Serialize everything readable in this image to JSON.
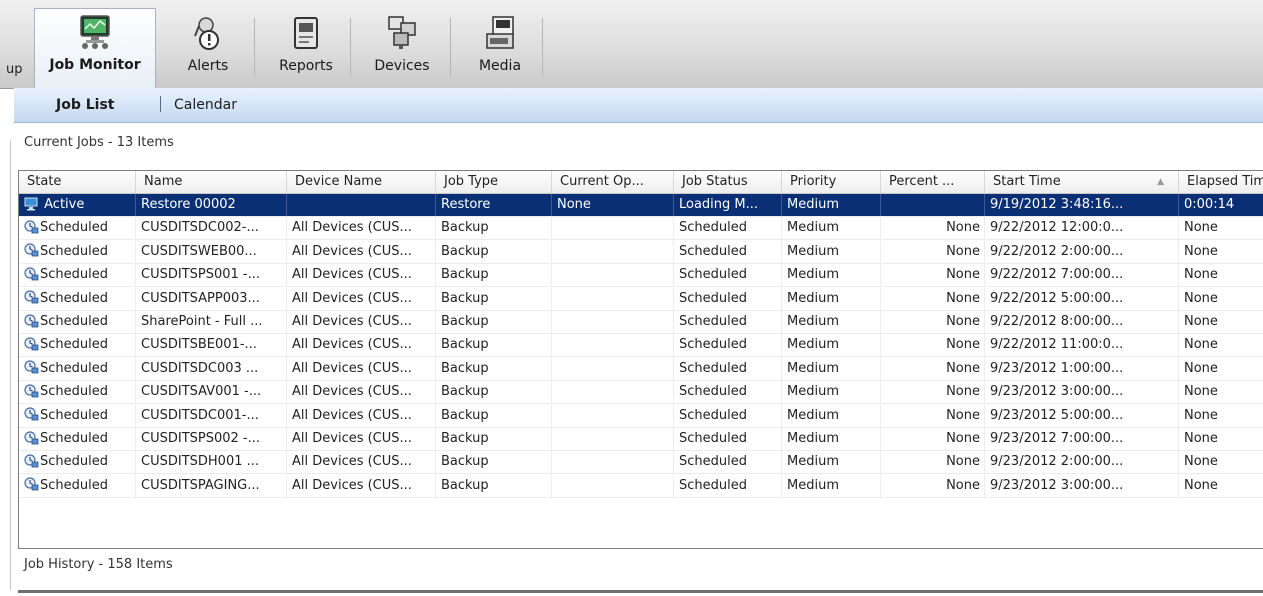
{
  "toolbar": {
    "cut_label": "up",
    "tabs": [
      {
        "label": "Job Monitor",
        "icon": "job-monitor-icon"
      },
      {
        "label": "Alerts",
        "icon": "alerts-icon"
      },
      {
        "label": "Reports",
        "icon": "reports-icon"
      },
      {
        "label": "Devices",
        "icon": "devices-icon"
      },
      {
        "label": "Media",
        "icon": "media-icon"
      }
    ]
  },
  "subnav": {
    "job_list": "Job List",
    "calendar": "Calendar"
  },
  "current_jobs": {
    "title": "Current Jobs - 13 Items",
    "columns": [
      "State",
      "Name",
      "Device Name",
      "Job Type",
      "Current Op...",
      "Job Status",
      "Priority",
      "Percent ...",
      "Start Time",
      "Elapsed Time"
    ],
    "rows": [
      [
        "Active",
        "Restore 00002",
        "",
        "Restore",
        "None",
        "Loading M...",
        "Medium",
        "",
        "9/19/2012 3:48:16...",
        "0:00:14"
      ],
      [
        "Scheduled",
        "CUSDITSDC002-...",
        "All Devices (CUS...",
        "Backup",
        "",
        "Scheduled",
        "Medium",
        "None",
        "9/22/2012 12:00:0...",
        "None"
      ],
      [
        "Scheduled",
        "CUSDITSWEB00...",
        "All Devices (CUS...",
        "Backup",
        "",
        "Scheduled",
        "Medium",
        "None",
        "9/22/2012 2:00:00...",
        "None"
      ],
      [
        "Scheduled",
        "CUSDITSPS001 -...",
        "All Devices (CUS...",
        "Backup",
        "",
        "Scheduled",
        "Medium",
        "None",
        "9/22/2012 7:00:00...",
        "None"
      ],
      [
        "Scheduled",
        "CUSDITSAPP003...",
        "All Devices (CUS...",
        "Backup",
        "",
        "Scheduled",
        "Medium",
        "None",
        "9/22/2012 5:00:00...",
        "None"
      ],
      [
        "Scheduled",
        "SharePoint - Full ...",
        "All Devices (CUS...",
        "Backup",
        "",
        "Scheduled",
        "Medium",
        "None",
        "9/22/2012 8:00:00...",
        "None"
      ],
      [
        "Scheduled",
        "CUSDITSBE001-...",
        "All Devices (CUS...",
        "Backup",
        "",
        "Scheduled",
        "Medium",
        "None",
        "9/22/2012 11:00:0...",
        "None"
      ],
      [
        "Scheduled",
        "CUSDITSDC003 ...",
        "All Devices (CUS...",
        "Backup",
        "",
        "Scheduled",
        "Medium",
        "None",
        "9/23/2012 1:00:00...",
        "None"
      ],
      [
        "Scheduled",
        "CUSDITSAV001 -...",
        "All Devices (CUS...",
        "Backup",
        "",
        "Scheduled",
        "Medium",
        "None",
        "9/23/2012 3:00:00...",
        "None"
      ],
      [
        "Scheduled",
        "CUSDITSDC001-...",
        "All Devices (CUS...",
        "Backup",
        "",
        "Scheduled",
        "Medium",
        "None",
        "9/23/2012 5:00:00...",
        "None"
      ],
      [
        "Scheduled",
        "CUSDITSPS002 -...",
        "All Devices (CUS...",
        "Backup",
        "",
        "Scheduled",
        "Medium",
        "None",
        "9/23/2012 7:00:00...",
        "None"
      ],
      [
        "Scheduled",
        "CUSDITSDH001 ...",
        "All Devices (CUS...",
        "Backup",
        "",
        "Scheduled",
        "Medium",
        "None",
        "9/23/2012 2:00:00...",
        "None"
      ],
      [
        "Scheduled",
        "CUSDITSPAGING...",
        "All Devices (CUS...",
        "Backup",
        "",
        "Scheduled",
        "Medium",
        "None",
        "9/23/2012 3:00:00...",
        "None"
      ]
    ]
  },
  "job_history": {
    "title": "Job History - 158 Items"
  },
  "colors": {
    "selected_row": "#0b2f74",
    "subnav_bg": "#c3d9f1"
  }
}
